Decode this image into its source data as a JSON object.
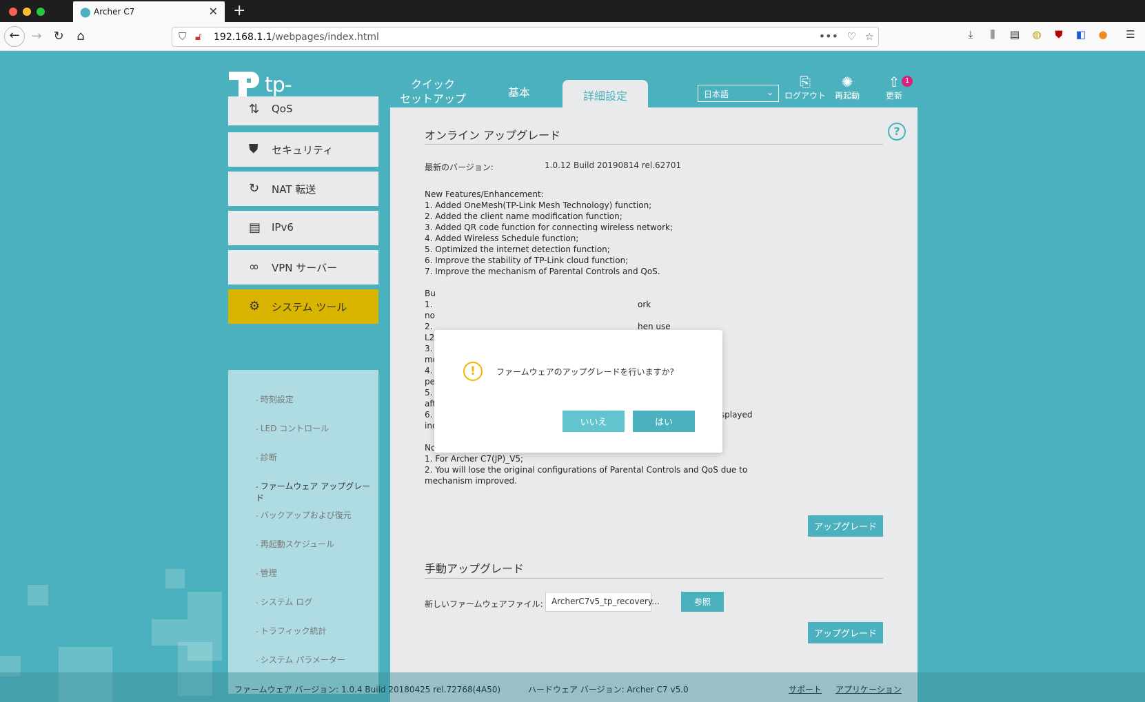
{
  "browser": {
    "tab_title": "Archer C7",
    "url_host": "192.168.1.1",
    "url_path": "/webpages/index.html"
  },
  "header": {
    "logo_text": "tp-link",
    "tabs": [
      {
        "label_line1": "クイック",
        "label_line2": "セットアップ"
      },
      {
        "label_line1": "基本",
        "label_line2": ""
      },
      {
        "label_line1": "詳細設定",
        "label_line2": ""
      }
    ],
    "language": "日本語",
    "logout": "ログアウト",
    "reboot": "再起動",
    "update": "更新",
    "update_badge": "1"
  },
  "sidebar": {
    "items": [
      {
        "label": "QoS",
        "icon": "updown-arrows-icon"
      },
      {
        "label": "セキュリティ",
        "icon": "shield-icon"
      },
      {
        "label": "NAT 転送",
        "icon": "refresh-icon"
      },
      {
        "label": "IPv6",
        "icon": "document-icon"
      },
      {
        "label": "VPN サーバー",
        "icon": "link-icon"
      },
      {
        "label": "システム ツール",
        "icon": "gear-icon"
      }
    ],
    "subitems": [
      "時刻設定",
      "LED コントロール",
      "診断",
      "ファームウェア アップグレード",
      "バックアップおよび復元",
      "再起動スケジュール",
      "管理",
      "システム ログ",
      "トラフィック統計",
      "システム パラメーター"
    ]
  },
  "online": {
    "title": "オンライン アップグレード",
    "latest_label": "最新のバージョン:",
    "latest_value": "1.0.12 Build 20190814 rel.62701",
    "notes": "New Features/Enhancement:\n1. Added OneMesh(TP-Link Mesh Technology) function;\n2. Added the client name modification function;\n3. Added QR code function for connecting wireless network;\n4. Added Wireless Schedule function;\n5. Optimized the internet detection function;\n6. Improve the stability of TP-Link cloud function;\n7. Improve the mechanism of Parental Controls and QoS.\n\nBu                                                                              \n1.                                                                              ork\nno                                                                              \n2.                                                                              hen use\nL2                                                                              \n3.                                                                              on AP\nmo                                                                              \n4.                                                                              proved the\npe                                                                              \n5.                                                                              reconnect\nafter modifying the wireless settings;\n6. Fixed the bug that sometimes the IP address of wireless devices is displayed\nincorrectly as 254.218.0.0 on the Tether APP.\n\nNote:\n1. For Archer C7(JP)_V5;\n2. You will lose the original configurations of Parental Controls and QoS due to\nmechanism improved.",
    "upgrade_button": "アップグレード"
  },
  "manual": {
    "title": "手動アップグレード",
    "file_label": "新しいファームウェアファイル:",
    "file_value": "ArcherC7v5_tp_recovery...",
    "browse_button": "参照",
    "upgrade_button": "アップグレード"
  },
  "modal": {
    "message": "ファームウェアのアップグレードを行いますか?",
    "no_button": "いいえ",
    "yes_button": "はい"
  },
  "footer": {
    "firmware": "ファームウェア バージョン: 1.0.4 Build 20180425 rel.72768(4A50)",
    "hardware": "ハードウェア バージョン: Archer C7 v5.0",
    "support": "サポート",
    "app": "アプリケーション"
  },
  "colors": {
    "brand": "#4cb1be",
    "active_nav": "#d9b400",
    "warning": "#f0b800",
    "badge": "#d4237a"
  }
}
